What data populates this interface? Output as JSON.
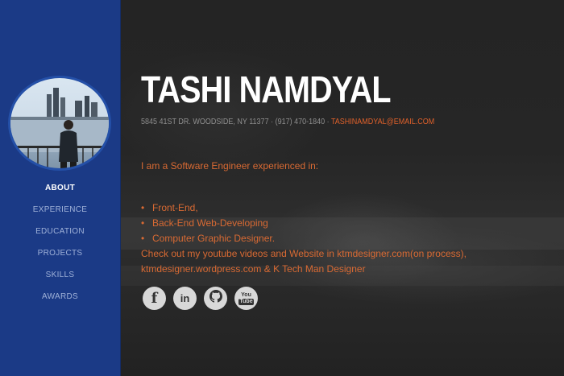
{
  "profile": {
    "name": "TASHI NAMDYAL",
    "address_phone": "5845 41ST DR. WOODSIDE, NY 11377 · (917) 470-1840 · ",
    "email": "TASHINAMDYAL@EMAIL.COM"
  },
  "nav": {
    "items": [
      {
        "label": "ABOUT",
        "active": true
      },
      {
        "label": "EXPERIENCE"
      },
      {
        "label": "EDUCATION"
      },
      {
        "label": "PROJECTS"
      },
      {
        "label": "SKILLS"
      },
      {
        "label": "AWARDS"
      }
    ]
  },
  "about": {
    "intro": "I am a Software Engineer experienced in:",
    "skills": [
      "Front-End,",
      "Back-End Web-Developing",
      "Computer Graphic Designer."
    ],
    "checkout_line1": "Check out my youtube videos and Website in ktmdesigner.com(on process),",
    "checkout_line2": "ktmdesigner.wordpress.com & K Tech Man Designer"
  },
  "social": {
    "facebook_glyph": "f",
    "linkedin_glyph": "in",
    "youtube_glyph_top": "You",
    "youtube_glyph_bottom": "Tube"
  },
  "colors": {
    "sidebar": "#1b3a86",
    "accent_orange": "#d96a33",
    "email_orange": "#e0612b",
    "nav_inactive": "#9fb1d8"
  },
  "icons": [
    "facebook-icon",
    "linkedin-icon",
    "github-icon",
    "youtube-icon"
  ]
}
